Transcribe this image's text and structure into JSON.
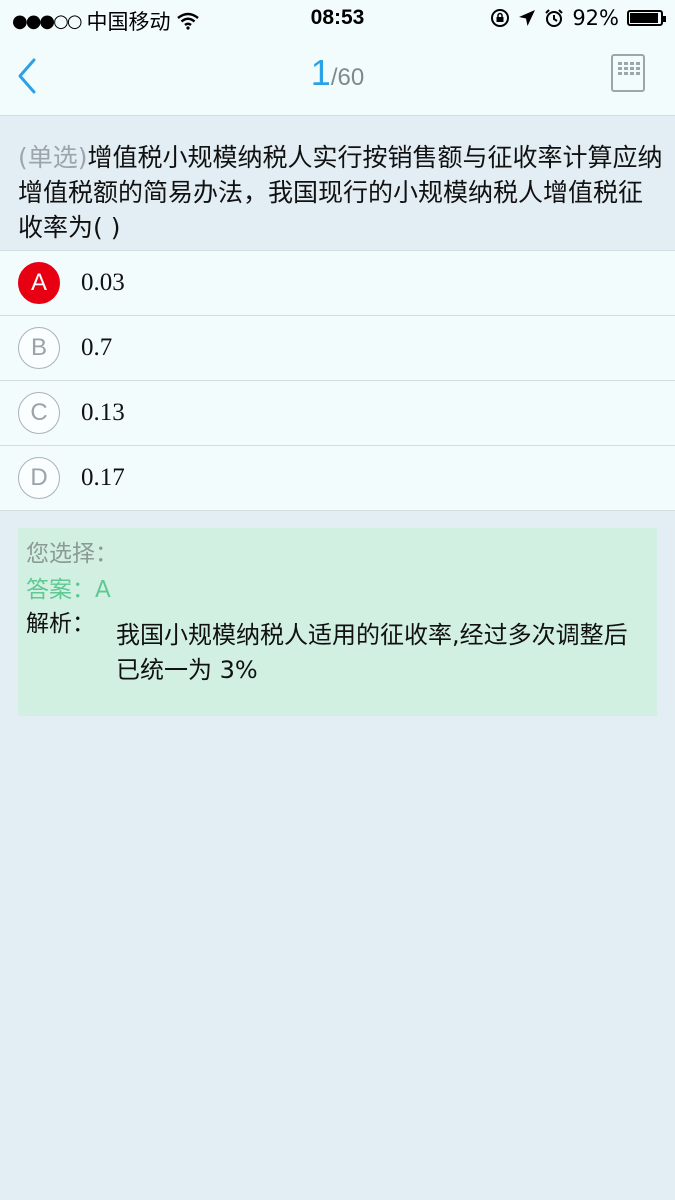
{
  "status_bar": {
    "carrier": "中国移动",
    "time": "08:53",
    "battery": "92%"
  },
  "nav": {
    "current": "1",
    "total": "/60"
  },
  "question": {
    "type_tag": "(单选)",
    "text": "增值税小规模纳税人实行按销售额与征收率计算应纳增值税额的简易办法，我国现行的小规模纳税人增值税征收率为( )"
  },
  "options": [
    {
      "letter": "A",
      "value": "0.03",
      "selected": true
    },
    {
      "letter": "B",
      "value": "0.7",
      "selected": false
    },
    {
      "letter": "C",
      "value": "0.13",
      "selected": false
    },
    {
      "letter": "D",
      "value": "0.17",
      "selected": false
    }
  ],
  "analysis": {
    "your_choice_label": "您选择：",
    "answer_label": "答案：",
    "answer_value": "A",
    "explanation_label": "解析：",
    "explanation_text": "我国小规模纳税人适用的征收率,经过多次调整后已统一为 3%"
  },
  "colors": {
    "accent": "#2aa2e6",
    "selected": "#e60012",
    "answer": "#5fc893"
  }
}
